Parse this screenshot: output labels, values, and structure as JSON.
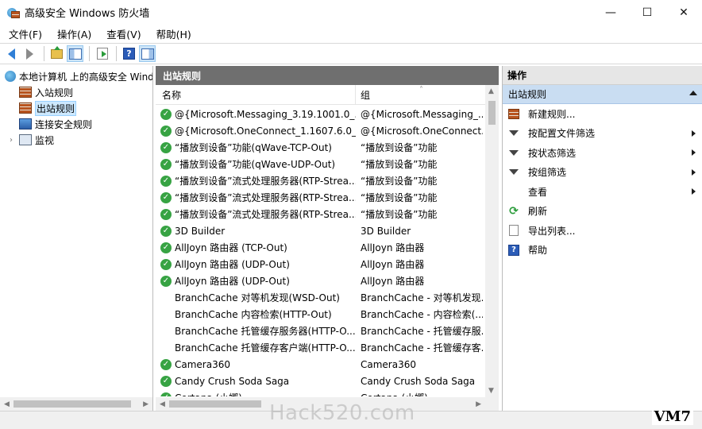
{
  "window": {
    "title": "高级安全 Windows 防火墙",
    "minimize": "—",
    "maximize": "☐",
    "close": "✕"
  },
  "menu": [
    "文件(F)",
    "操作(A)",
    "查看(V)",
    "帮助(H)"
  ],
  "tree": {
    "root": "本地计算机 上的高级安全 Windows 防火墙",
    "items": [
      "入站规则",
      "出站规则",
      "连接安全规则",
      "监视"
    ],
    "selected": "出站规则"
  },
  "center": {
    "header": "出站规则",
    "columns": {
      "name": "名称",
      "group": "组"
    },
    "rows": [
      {
        "name": "@{Microsoft.Messaging_3.19.1001.0_...",
        "group": "@{Microsoft.Messaging_...",
        "enabled": true
      },
      {
        "name": "@{Microsoft.OneConnect_1.1607.6.0_...",
        "group": "@{Microsoft.OneConnect...",
        "enabled": true
      },
      {
        "name": "“播放到设备”功能(qWave-TCP-Out)",
        "group": "“播放到设备”功能",
        "enabled": true
      },
      {
        "name": "“播放到设备”功能(qWave-UDP-Out)",
        "group": "“播放到设备”功能",
        "enabled": true
      },
      {
        "name": "“播放到设备”流式处理服务器(RTP-Strea...",
        "group": "“播放到设备”功能",
        "enabled": true
      },
      {
        "name": "“播放到设备”流式处理服务器(RTP-Strea...",
        "group": "“播放到设备”功能",
        "enabled": true
      },
      {
        "name": "“播放到设备”流式处理服务器(RTP-Strea...",
        "group": "“播放到设备”功能",
        "enabled": true
      },
      {
        "name": "3D Builder",
        "group": "3D Builder",
        "enabled": true
      },
      {
        "name": "AllJoyn 路由器 (TCP-Out)",
        "group": "AllJoyn 路由器",
        "enabled": true
      },
      {
        "name": "AllJoyn 路由器 (UDP-Out)",
        "group": "AllJoyn 路由器",
        "enabled": true
      },
      {
        "name": "AllJoyn 路由器 (UDP-Out)",
        "group": "AllJoyn 路由器",
        "enabled": true
      },
      {
        "name": "BranchCache 对等机发现(WSD-Out)",
        "group": "BranchCache - 对等机发现...",
        "enabled": false
      },
      {
        "name": "BranchCache 内容检索(HTTP-Out)",
        "group": "BranchCache - 内容检索(...",
        "enabled": false
      },
      {
        "name": "BranchCache 托管缓存服务器(HTTP-O...",
        "group": "BranchCache - 托管缓存服...",
        "enabled": false
      },
      {
        "name": "BranchCache 托管缓存客户端(HTTP-O...",
        "group": "BranchCache - 托管缓存客...",
        "enabled": false
      },
      {
        "name": "Camera360",
        "group": "Camera360",
        "enabled": true
      },
      {
        "name": "Candy Crush Soda Saga",
        "group": "Candy Crush Soda Saga",
        "enabled": true
      },
      {
        "name": "Cortana (小娜)",
        "group": "Cortana (小娜)",
        "enabled": true
      }
    ]
  },
  "actions": {
    "title": "操作",
    "section": "出站规则",
    "items": [
      {
        "label": "新建规则...",
        "icon": "new-rule-icon",
        "submenu": false
      },
      {
        "label": "按配置文件筛选",
        "icon": "filter-icon",
        "submenu": true
      },
      {
        "label": "按状态筛选",
        "icon": "filter-icon",
        "submenu": true
      },
      {
        "label": "按组筛选",
        "icon": "filter-icon",
        "submenu": true
      },
      {
        "label": "查看",
        "icon": "",
        "submenu": true
      },
      {
        "label": "刷新",
        "icon": "refresh-icon",
        "submenu": false
      },
      {
        "label": "导出列表...",
        "icon": "export-list-icon",
        "submenu": false
      },
      {
        "label": "帮助",
        "icon": "help-icon",
        "submenu": false
      }
    ]
  },
  "watermark": "Hack520.com",
  "badge": "VM7",
  "colors": {
    "enabled_check": "#37a343",
    "pane_header": "#6f6f6f",
    "section_bg": "#c9ddf2",
    "selection": "#cce8ff"
  }
}
